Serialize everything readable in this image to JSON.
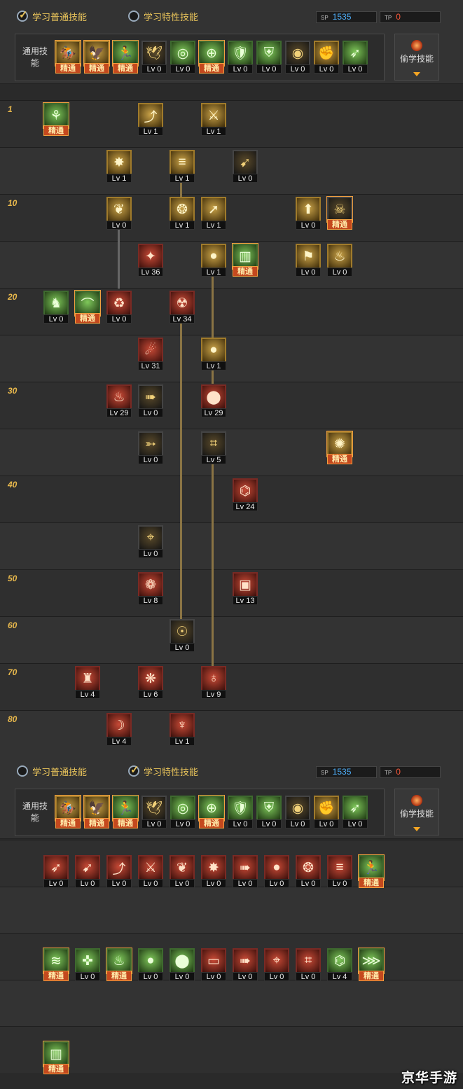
{
  "header": {
    "tab_normal": "学习普通技能",
    "tab_special": "学习特性技能",
    "sp_value": "1535",
    "tp_value": "0",
    "sp_code": "SP",
    "tp_code": "TP",
    "common_label": "通用技能",
    "steal_label": "偷学技能"
  },
  "mastered_label": "精通",
  "colors": {
    "accent": "#e8c35a",
    "sp": "#4fb2ff",
    "tp": "#ff5a3c",
    "mastery": "#c4491e",
    "link_line": "#8a7444"
  },
  "common_skills": [
    {
      "icon": "mount-icon",
      "glyph": "🏇",
      "tone": "gold",
      "level": "精通",
      "mastered": true
    },
    {
      "icon": "leap-icon",
      "glyph": "🦅",
      "tone": "gold",
      "level": "精通",
      "mastered": true
    },
    {
      "icon": "sprint-icon",
      "glyph": "🏃",
      "tone": "green",
      "level": "精通",
      "mastered": true
    },
    {
      "icon": "wings-icon",
      "glyph": "🕊",
      "tone": "dark",
      "level": "Lv 0",
      "mastered": false
    },
    {
      "icon": "target-icon",
      "glyph": "◎",
      "tone": "green",
      "level": "Lv 0",
      "mastered": false
    },
    {
      "icon": "crosshair-icon",
      "glyph": "⊕",
      "tone": "green",
      "level": "精通",
      "mastered": true
    },
    {
      "icon": "guard-icon",
      "glyph": "🛡",
      "tone": "green",
      "level": "Lv 0",
      "mastered": false
    },
    {
      "icon": "shield-icon",
      "glyph": "⛨",
      "tone": "green",
      "level": "Lv 0",
      "mastered": false
    },
    {
      "icon": "eye-icon",
      "glyph": "◉",
      "tone": "dark",
      "level": "Lv 0",
      "mastered": false
    },
    {
      "icon": "strength-icon",
      "glyph": "✊",
      "tone": "gold",
      "level": "Lv 0",
      "mastered": false
    },
    {
      "icon": "dash-icon",
      "glyph": "➶",
      "tone": "green",
      "level": "Lv 0",
      "mastered": false
    }
  ],
  "tree_rows": [
    {
      "label": "1"
    },
    {
      "label": ""
    },
    {
      "label": "10"
    },
    {
      "label": ""
    },
    {
      "label": "20"
    },
    {
      "label": ""
    },
    {
      "label": "30"
    },
    {
      "label": ""
    },
    {
      "label": "40"
    },
    {
      "label": ""
    },
    {
      "label": "50"
    },
    {
      "label": "60"
    },
    {
      "label": "70"
    },
    {
      "label": "80"
    }
  ],
  "tree_skills": [
    {
      "row": 0,
      "col": 0,
      "glyph": "⚘",
      "tone": "green",
      "level": "精通",
      "mastered": true,
      "icon": "vine-icon"
    },
    {
      "row": 0,
      "col": 3,
      "glyph": "⤴",
      "tone": "gold",
      "level": "Lv 1",
      "mastered": false,
      "icon": "uppercut-icon"
    },
    {
      "row": 0,
      "col": 5,
      "glyph": "⚔",
      "tone": "gold",
      "level": "Lv 1",
      "mastered": false,
      "icon": "slash-icon"
    },
    {
      "row": 1,
      "col": 2,
      "glyph": "✸",
      "tone": "gold",
      "level": "Lv 1",
      "mastered": false,
      "icon": "burst-icon"
    },
    {
      "row": 1,
      "col": 4,
      "glyph": "≡",
      "tone": "gold",
      "level": "Lv 1",
      "mastered": false,
      "icon": "rapid-shot-icon"
    },
    {
      "row": 1,
      "col": 6,
      "glyph": "➹",
      "tone": "dark",
      "level": "Lv 0",
      "mastered": false,
      "icon": "arrow-icon"
    },
    {
      "row": 2,
      "col": 2,
      "glyph": "❦",
      "tone": "gold",
      "level": "Lv 0",
      "mastered": false,
      "icon": "blade-icon"
    },
    {
      "row": 2,
      "col": 4,
      "glyph": "❂",
      "tone": "gold",
      "level": "Lv 1",
      "mastered": false,
      "icon": "beast-icon"
    },
    {
      "row": 2,
      "col": 5,
      "glyph": "➚",
      "tone": "gold",
      "level": "Lv 1",
      "mastered": false,
      "icon": "spear-icon"
    },
    {
      "row": 2,
      "col": 8,
      "glyph": "⬆",
      "tone": "gold",
      "level": "Lv 0",
      "mastered": false,
      "icon": "launch-icon"
    },
    {
      "row": 2,
      "col": 9,
      "glyph": "☠",
      "tone": "dark",
      "level": "精通",
      "mastered": true,
      "icon": "mask-icon"
    },
    {
      "row": 3,
      "col": 3,
      "glyph": "✦",
      "tone": "red",
      "level": "Lv 36",
      "mastered": false,
      "icon": "spark-icon"
    },
    {
      "row": 3,
      "col": 5,
      "glyph": "●",
      "tone": "gold",
      "level": "Lv 1",
      "mastered": false,
      "icon": "grenade-icon"
    },
    {
      "row": 3,
      "col": 6,
      "glyph": "▥",
      "tone": "green",
      "level": "精通",
      "mastered": true,
      "icon": "ammo-icon"
    },
    {
      "row": 3,
      "col": 8,
      "glyph": "⚑",
      "tone": "gold",
      "level": "Lv 0",
      "mastered": false,
      "icon": "flag-icon"
    },
    {
      "row": 3,
      "col": 9,
      "glyph": "♨",
      "tone": "gold",
      "level": "Lv 0",
      "mastered": false,
      "icon": "ground-icon"
    },
    {
      "row": 4,
      "col": 0,
      "glyph": "♞",
      "tone": "green",
      "level": "Lv 0",
      "mastered": false,
      "icon": "pistol-icon"
    },
    {
      "row": 4,
      "col": 1,
      "glyph": "⌒",
      "tone": "green",
      "level": "精通",
      "mastered": true,
      "icon": "bow-icon"
    },
    {
      "row": 4,
      "col": 2,
      "glyph": "♻",
      "tone": "red",
      "level": "Lv 0",
      "mastered": false,
      "icon": "swap-icon"
    },
    {
      "row": 4,
      "col": 4,
      "glyph": "☢",
      "tone": "red",
      "level": "Lv 34",
      "mastered": false,
      "icon": "bomb-icon"
    },
    {
      "row": 5,
      "col": 3,
      "glyph": "☄",
      "tone": "red",
      "level": "Lv 31",
      "mastered": false,
      "icon": "fire-claw-icon"
    },
    {
      "row": 5,
      "col": 5,
      "glyph": "●",
      "tone": "gold",
      "level": "Lv 1",
      "mastered": false,
      "icon": "grenade2-icon"
    },
    {
      "row": 6,
      "col": 2,
      "glyph": "♨",
      "tone": "red",
      "level": "Lv 29",
      "mastered": false,
      "icon": "flame-icon"
    },
    {
      "row": 6,
      "col": 3,
      "glyph": "➠",
      "tone": "dark",
      "level": "Lv 0",
      "mastered": false,
      "icon": "bolt-icon"
    },
    {
      "row": 6,
      "col": 5,
      "glyph": "⬤",
      "tone": "red",
      "level": "Lv 29",
      "mastered": false,
      "icon": "cluster-bomb-icon"
    },
    {
      "row": 7,
      "col": 3,
      "glyph": "➳",
      "tone": "dark",
      "level": "Lv 0",
      "mastered": false,
      "icon": "drill-icon"
    },
    {
      "row": 7,
      "col": 5,
      "glyph": "⌗",
      "tone": "dark",
      "level": "Lv 5",
      "mastered": false,
      "icon": "mine-icon"
    },
    {
      "row": 7,
      "col": 9,
      "glyph": "✺",
      "tone": "gold",
      "level": "精通",
      "mastered": true,
      "icon": "flash-icon"
    },
    {
      "row": 8,
      "col": 6,
      "glyph": "⌬",
      "tone": "red",
      "level": "Lv 24",
      "mastered": false,
      "icon": "jaws-icon"
    },
    {
      "row": 9,
      "col": 3,
      "glyph": "⌖",
      "tone": "dark",
      "level": "Lv 0",
      "mastered": false,
      "icon": "scope-icon"
    },
    {
      "row": 10,
      "col": 3,
      "glyph": "❁",
      "tone": "red",
      "level": "Lv 8",
      "mastered": false,
      "icon": "explosion-icon"
    },
    {
      "row": 10,
      "col": 6,
      "glyph": "▣",
      "tone": "red",
      "level": "Lv 13",
      "mastered": false,
      "icon": "cannon-icon"
    },
    {
      "row": 11,
      "col": 4,
      "glyph": "☉",
      "tone": "dark",
      "level": "Lv 0",
      "mastered": false,
      "icon": "satellite-icon"
    },
    {
      "row": 12,
      "col": 1,
      "glyph": "♜",
      "tone": "red",
      "level": "Lv 4",
      "mastered": false,
      "icon": "turret-icon"
    },
    {
      "row": 12,
      "col": 3,
      "glyph": "❋",
      "tone": "red",
      "level": "Lv 6",
      "mastered": false,
      "icon": "blast-icon"
    },
    {
      "row": 12,
      "col": 5,
      "glyph": "♁",
      "tone": "red",
      "level": "Lv 9",
      "mastered": false,
      "icon": "vortex-icon"
    },
    {
      "row": 13,
      "col": 2,
      "glyph": "☽",
      "tone": "red",
      "level": "Lv 4",
      "mastered": false,
      "icon": "scythe-icon"
    },
    {
      "row": 13,
      "col": 4,
      "glyph": "♆",
      "tone": "red",
      "level": "Lv 1",
      "mastered": false,
      "icon": "awakening-icon"
    }
  ],
  "special_rows": [
    [
      {
        "glyph": "➶",
        "tone": "red",
        "level": "Lv 0",
        "mastered": false,
        "icon": "rush-icon"
      },
      {
        "glyph": "➹",
        "tone": "red",
        "level": "Lv 0",
        "mastered": false,
        "icon": "pierce-icon"
      },
      {
        "glyph": "⤴",
        "tone": "red",
        "level": "Lv 0",
        "mastered": false,
        "icon": "rise-icon"
      },
      {
        "glyph": "⚔",
        "tone": "red",
        "level": "Lv 0",
        "mastered": false,
        "icon": "cross-slash-icon"
      },
      {
        "glyph": "❦",
        "tone": "red",
        "level": "Lv 0",
        "mastered": false,
        "icon": "leaf-blade-icon"
      },
      {
        "glyph": "✸",
        "tone": "red",
        "level": "Lv 0",
        "mastered": false,
        "icon": "nova-icon"
      },
      {
        "glyph": "➠",
        "tone": "red",
        "level": "Lv 0",
        "mastered": false,
        "icon": "missile-icon"
      },
      {
        "glyph": "●",
        "tone": "red",
        "level": "Lv 0",
        "mastered": false,
        "icon": "orb-icon"
      },
      {
        "glyph": "❂",
        "tone": "red",
        "level": "Lv 0",
        "mastered": false,
        "icon": "roar-icon"
      },
      {
        "glyph": "≡",
        "tone": "red",
        "level": "Lv 0",
        "mastered": false,
        "icon": "volley-icon"
      },
      {
        "glyph": "🏃",
        "tone": "green",
        "level": "精通",
        "mastered": true,
        "icon": "sprint2-icon"
      }
    ],
    [
      {
        "glyph": "≋",
        "tone": "green",
        "level": "精通",
        "mastered": true,
        "icon": "gale-icon"
      },
      {
        "glyph": "✜",
        "tone": "green",
        "level": "Lv 0",
        "mastered": false,
        "icon": "cross-arrow-icon"
      },
      {
        "glyph": "♨",
        "tone": "green",
        "level": "精通",
        "mastered": true,
        "icon": "fire-icon"
      },
      {
        "glyph": "●",
        "tone": "green",
        "level": "Lv 0",
        "mastered": false,
        "icon": "grenade-green-icon"
      },
      {
        "glyph": "⬤",
        "tone": "green",
        "level": "Lv 0",
        "mastered": false,
        "icon": "bomb-green-icon"
      },
      {
        "glyph": "▭",
        "tone": "red",
        "level": "Lv 0",
        "mastered": false,
        "icon": "rocket-icon"
      },
      {
        "glyph": "➠",
        "tone": "red",
        "level": "Lv 0",
        "mastered": false,
        "icon": "dart-icon"
      },
      {
        "glyph": "⌖",
        "tone": "red",
        "level": "Lv 0",
        "mastered": false,
        "icon": "lock-on-icon"
      },
      {
        "glyph": "⌗",
        "tone": "red",
        "level": "Lv 0",
        "mastered": false,
        "icon": "trap-icon"
      },
      {
        "glyph": "⌬",
        "tone": "green",
        "level": "Lv 4",
        "mastered": false,
        "icon": "beetle-icon"
      },
      {
        "glyph": "⋙",
        "tone": "green",
        "level": "精通",
        "mastered": true,
        "icon": "teeth-icon"
      }
    ],
    [
      {
        "glyph": "▥",
        "tone": "green",
        "level": "精通",
        "mastered": true,
        "icon": "magazine-icon"
      }
    ]
  ],
  "watermark": "京华手游"
}
